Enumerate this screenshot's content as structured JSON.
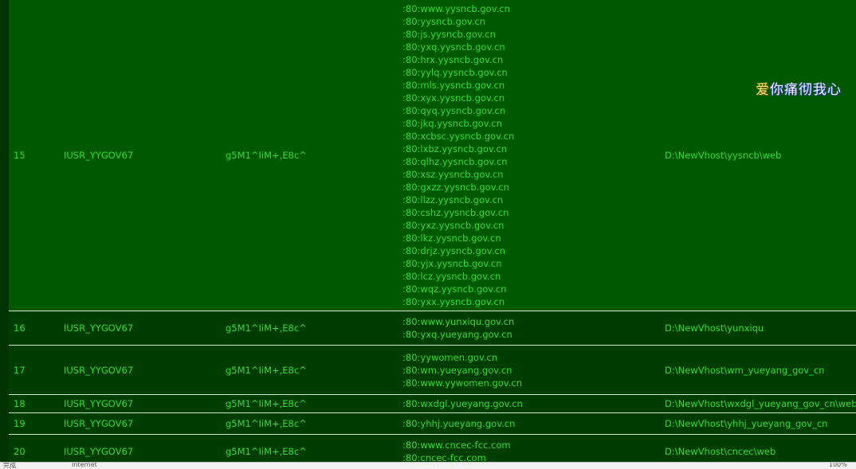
{
  "rows": [
    {
      "id": "15",
      "user": "IUSR_YYGOV67",
      "password": "g5M1^IiM+,E8c^",
      "hosts": [
        ":80:www.yysncb.gov.cn",
        ":80:yysncb.gov.cn",
        ":80:js.yysncb.gov.cn",
        ":80:yxq.yysncb.gov.cn",
        ":80:hrx.yysncb.gov.cn",
        ":80:yylq.yysncb.gov.cn",
        ":80:mls.yysncb.gov.cn",
        ":80:xyx.yysncb.gov.cn",
        ":80:qyq.yysncb.gov.cn",
        ":80:jkq.yysncb.gov.cn",
        ":80:xcbsc.yysncb.gov.cn",
        ":80:lxbz.yysncb.gov.cn",
        ":80:qlhz.yysncb.gov.cn",
        ":80:xsz.yysncb.gov.cn",
        ":80:gxzz.yysncb.gov.cn",
        ":80:llzz.yysncb.gov.cn",
        ":80:cshz.yysncb.gov.cn",
        ":80:yxz.yysncb.gov.cn",
        ":80:lkz.yysncb.gov.cn",
        ":80:drjz.yysncb.gov.cn",
        ":80:yjx.yysncb.gov.cn",
        ":80:lcz.yysncb.gov.cn",
        ":80:wqz.yysncb.gov.cn",
        ":80:yxx.yysncb.gov.cn"
      ],
      "path": "D:\\NewVhost\\yysncb\\web"
    },
    {
      "id": "16",
      "user": "IUSR_YYGOV67",
      "password": "g5M1^IiM+,E8c^",
      "hosts": [
        ":80:www.yunxiqu.gov.cn",
        ":80:yxq.yueyang.gov.cn"
      ],
      "path": "D:\\NewVhost\\yunxiqu"
    },
    {
      "id": "17",
      "user": "IUSR_YYGOV67",
      "password": "g5M1^IiM+,E8c^",
      "hosts": [
        ":80:yywomen.gov.cn",
        ":80:wm.yueyang.gov.cn",
        ":80:www.yywomen.gov.cn"
      ],
      "path": "D:\\NewVhost\\wm_yueyang_gov_cn"
    },
    {
      "id": "18",
      "user": "IUSR_YYGOV67",
      "password": "g5M1^IiM+,E8c^",
      "hosts": [
        ":80:wxdgl.yueyang.gov.cn"
      ],
      "path": "D:\\NewVhost\\wxdgl_yueyang_gov_cn\\web"
    },
    {
      "id": "19",
      "user": "IUSR_YYGOV67",
      "password": "g5M1^IiM+,E8c^",
      "hosts": [
        ":80:yhhj.yueyang.gov.cn"
      ],
      "path": "D:\\NewVhost\\yhhj_yueyang_gov_cn"
    },
    {
      "id": "20",
      "user": "IUSR_YYGOV67",
      "password": "g5M1^IiM+,E8c^",
      "hosts": [
        ":80:www.cncec-fcc.com",
        ":80:cncec-fcc.com"
      ],
      "path": "D:\\NewVhost\\cncec\\web"
    }
  ],
  "marquee": {
    "first_char": "爱",
    "rest": "你痛彻我心"
  },
  "statusbar": {
    "left": "完成",
    "center": "Internet",
    "right": "100%"
  },
  "colors": {
    "background": "#003d00",
    "highlight_row": "#005800",
    "text": "#33dd33",
    "separator": "#cfe8cf"
  }
}
